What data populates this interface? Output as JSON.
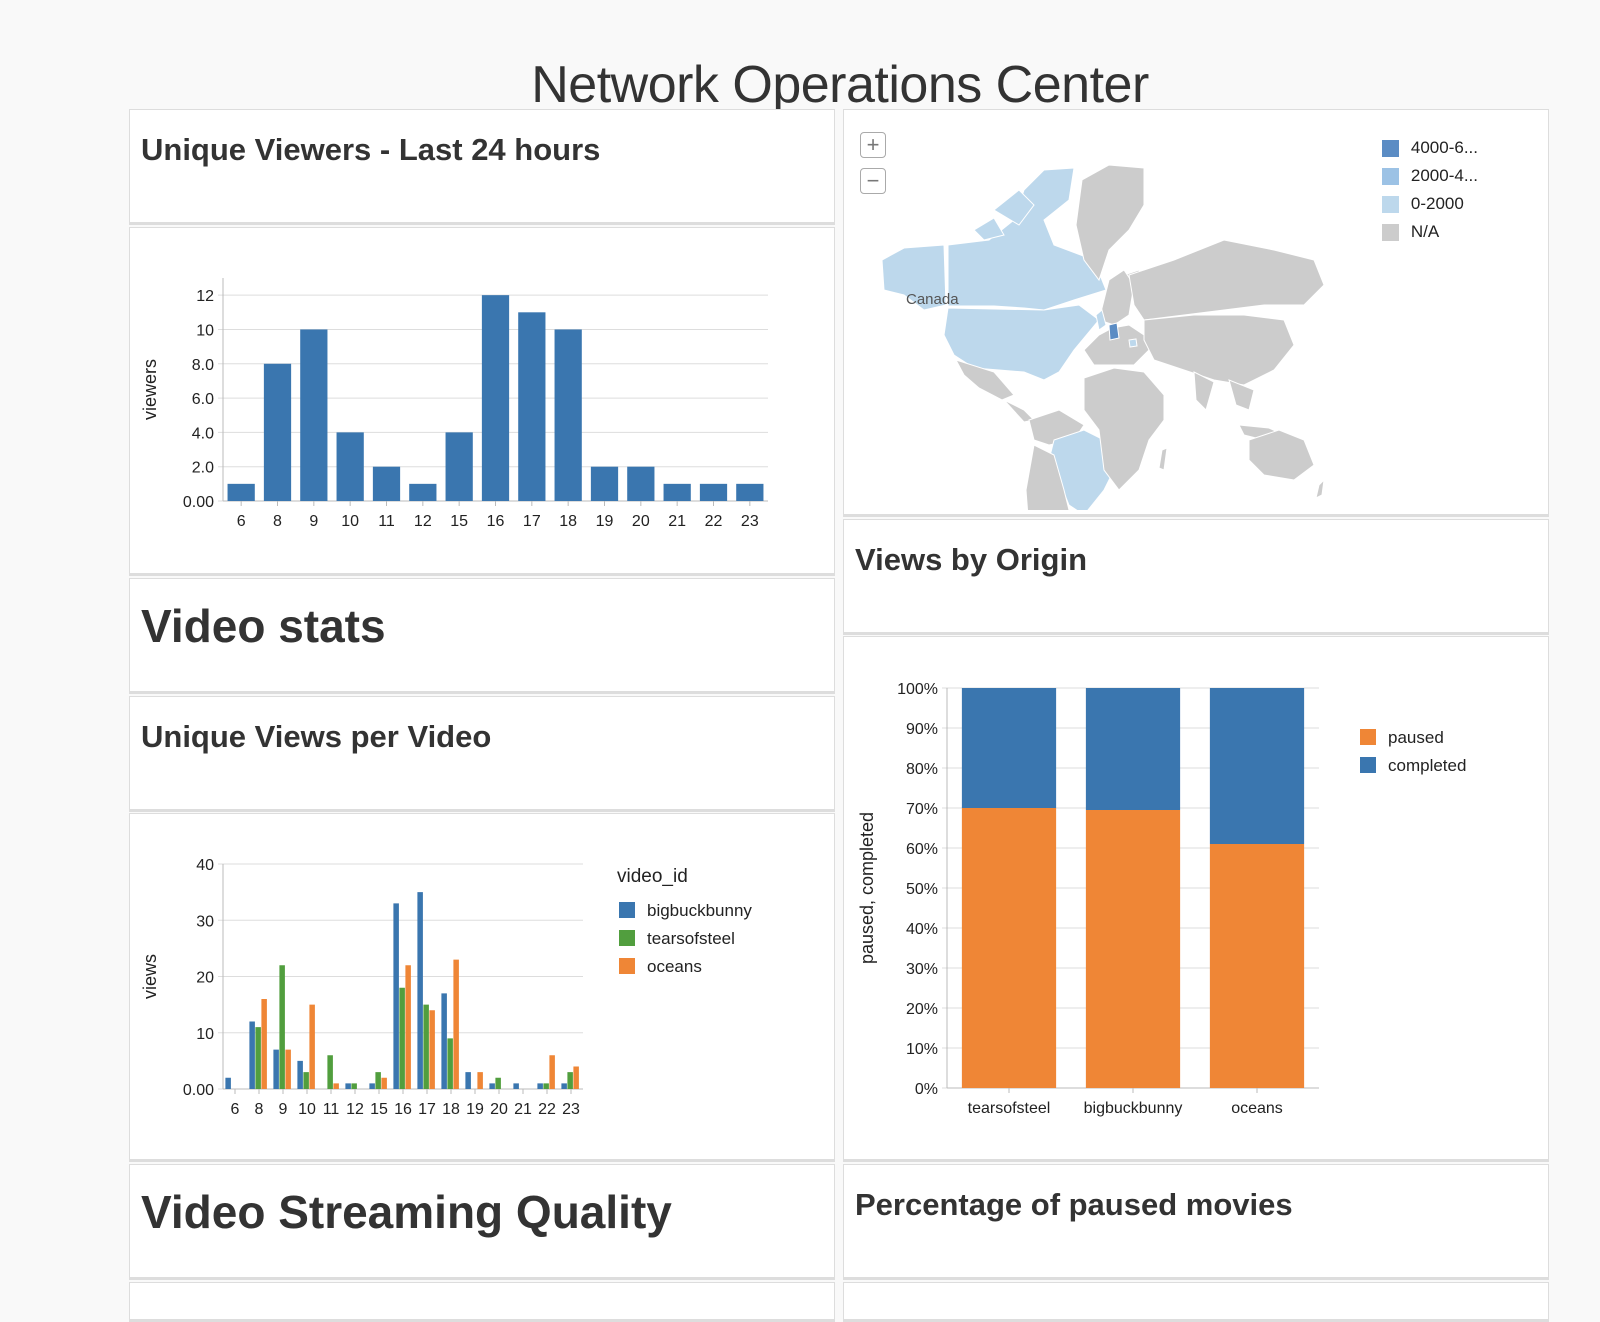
{
  "page": {
    "title": "Network Operations Center"
  },
  "panels": {
    "unique_viewers_title": "Unique Viewers - Last 24 hours",
    "video_stats_title": "Video stats",
    "unique_views_per_video_title": "Unique Views per Video",
    "video_streaming_quality_title": "Video Streaming Quality",
    "views_by_origin_title": "Views by Origin",
    "paused_pct_title": "Percentage of paused movies"
  },
  "map": {
    "zoom_in_label": "+",
    "zoom_out_label": "−",
    "country_label": "Canada",
    "legend": [
      {
        "label": "4000-6...",
        "color": "#5b8cc4"
      },
      {
        "label": "2000-4...",
        "color": "#9cc2e5"
      },
      {
        "label": "0-2000",
        "color": "#bdd8ec"
      },
      {
        "label": "N/A",
        "color": "#cccccc"
      }
    ],
    "highlighted": {
      "4000-6...": [
        "Germany"
      ],
      "0-2000": [
        "Canada",
        "United States",
        "Alaska",
        "Brazil",
        "United Kingdom",
        "Romania"
      ]
    }
  },
  "chart_data": [
    {
      "id": "unique_viewers",
      "type": "bar",
      "title": "Unique Viewers - Last 24 hours",
      "xlabel": "",
      "ylabel": "viewers",
      "categories": [
        "6",
        "8",
        "9",
        "10",
        "11",
        "12",
        "15",
        "16",
        "17",
        "18",
        "19",
        "20",
        "21",
        "22",
        "23"
      ],
      "values": [
        1,
        8,
        10,
        4,
        2,
        1,
        4,
        12,
        11,
        10,
        2,
        2,
        1,
        1,
        1
      ],
      "ylim": [
        0,
        13
      ],
      "yticks": [
        "0.00",
        "2.0",
        "4.0",
        "6.0",
        "8.0",
        "10",
        "12"
      ],
      "ytick_values": [
        0,
        2,
        4,
        6,
        8,
        10,
        12
      ],
      "color": "#3a76af",
      "grid": true
    },
    {
      "id": "views_per_video",
      "type": "bar",
      "title": "Unique Views per Video",
      "xlabel": "",
      "ylabel": "views",
      "categories": [
        "6",
        "8",
        "9",
        "10",
        "11",
        "12",
        "15",
        "16",
        "17",
        "18",
        "19",
        "20",
        "21",
        "22",
        "23"
      ],
      "series": [
        {
          "name": "bigbuckbunny",
          "color": "#3a76af",
          "values": [
            2,
            12,
            7,
            5,
            0,
            1,
            1,
            33,
            35,
            17,
            3,
            1,
            1,
            1,
            1
          ]
        },
        {
          "name": "tearsofsteel",
          "color": "#519e3e",
          "values": [
            0,
            11,
            22,
            3,
            6,
            1,
            3,
            18,
            15,
            9,
            0,
            2,
            0,
            1,
            3
          ]
        },
        {
          "name": "oceans",
          "color": "#ef8636",
          "values": [
            0,
            16,
            7,
            15,
            1,
            0,
            2,
            22,
            14,
            23,
            3,
            0,
            0,
            6,
            4
          ]
        }
      ],
      "legend_title": "video_id",
      "legend_position": "right",
      "ylim": [
        0,
        40
      ],
      "yticks": [
        "0.00",
        "10",
        "20",
        "30",
        "40"
      ],
      "ytick_values": [
        0,
        10,
        20,
        30,
        40
      ],
      "grid": true
    },
    {
      "id": "paused_completed",
      "type": "bar",
      "stacked": "normalized",
      "title": "Percentage of paused movies",
      "xlabel": "",
      "ylabel": "paused, completed",
      "categories": [
        "tearsofsteel",
        "bigbuckbunny",
        "oceans"
      ],
      "series": [
        {
          "name": "paused",
          "color": "#ef8636",
          "values": [
            70,
            69.5,
            61
          ]
        },
        {
          "name": "completed",
          "color": "#3a76af",
          "values": [
            30,
            30.5,
            39
          ]
        }
      ],
      "legend_position": "right",
      "ylim": [
        0,
        100
      ],
      "yticks": [
        "0%",
        "10%",
        "20%",
        "30%",
        "40%",
        "50%",
        "60%",
        "70%",
        "80%",
        "90%",
        "100%"
      ],
      "ytick_values": [
        0,
        10,
        20,
        30,
        40,
        50,
        60,
        70,
        80,
        90,
        100
      ],
      "grid": true
    }
  ]
}
